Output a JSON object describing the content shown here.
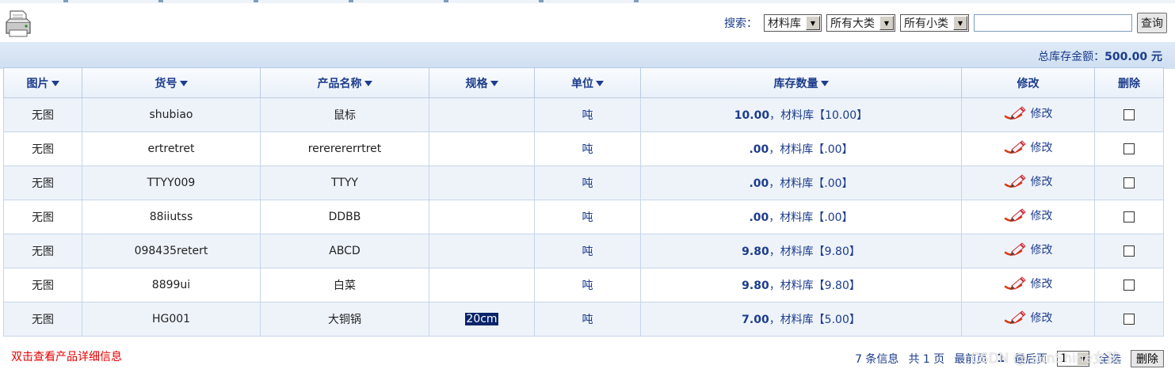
{
  "search": {
    "label": "搜索：",
    "select1": "材料库",
    "select2": "所有大类",
    "select3": "所有小类",
    "input_value": "",
    "button": "查询"
  },
  "summary": {
    "label": "总库存金额：",
    "value": "500.00 元"
  },
  "table": {
    "headers": {
      "image": "图片",
      "code": "货号",
      "name": "产品名称",
      "spec": "规格",
      "unit": "单位",
      "qty": "库存数量",
      "edit": "修改",
      "delete": "删除"
    },
    "rows": [
      {
        "image": "无图",
        "code": "shubiao",
        "name": "鼠标",
        "spec": "",
        "unit": "吨",
        "qty_value": "10.00",
        "qty_detail": "，材料库【10.00】",
        "edit": "修改"
      },
      {
        "image": "无图",
        "code": "ertretret",
        "name": "rererererrtret",
        "spec": "",
        "unit": "吨",
        "qty_value": ".00",
        "qty_detail": "，材料库【.00】",
        "edit": "修改"
      },
      {
        "image": "无图",
        "code": "TTYY009",
        "name": "TTYY",
        "spec": "",
        "unit": "吨",
        "qty_value": ".00",
        "qty_detail": "，材料库【.00】",
        "edit": "修改"
      },
      {
        "image": "无图",
        "code": "88iiutss",
        "name": "DDBB",
        "spec": "",
        "unit": "吨",
        "qty_value": ".00",
        "qty_detail": "，材料库【.00】",
        "edit": "修改"
      },
      {
        "image": "无图",
        "code": "098435retert",
        "name": "ABCD",
        "spec": "",
        "unit": "吨",
        "qty_value": "9.80",
        "qty_detail": "，材料库【9.80】",
        "edit": "修改"
      },
      {
        "image": "无图",
        "code": "8899ui",
        "name": "白菜",
        "spec": "",
        "unit": "吨",
        "qty_value": "9.80",
        "qty_detail": "，材料库【9.80】",
        "edit": "修改"
      },
      {
        "image": "无图",
        "code": "HG001",
        "name": "大铜锅",
        "spec": "20cm",
        "unit": "吨",
        "qty_value": "7.00",
        "qty_detail": "，材料库【5.00】",
        "edit": "修改"
      }
    ]
  },
  "footer": {
    "hint": "双击查看产品详细信息",
    "records": "7 条信息",
    "pages": "共 1 页",
    "first": "最前页",
    "current": "1",
    "last": "最后页",
    "select_page": "1",
    "select_all": "全选",
    "delete_button": "删除",
    "watermark": "CSDN @ sunShine女孩"
  },
  "colors": {
    "accent": "#1c3c8c",
    "header_bg": "#dfeaf7",
    "row_alt": "#eef3fa",
    "hint": "#e60000"
  },
  "icons": {
    "printer": "printer-icon",
    "edit": "edit-pencil-icon",
    "sort": "sort-caret-icon"
  }
}
